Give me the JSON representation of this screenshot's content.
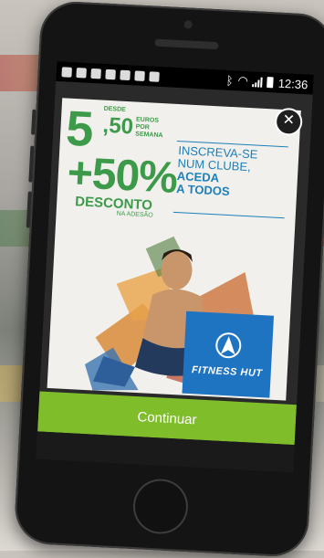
{
  "statusbar": {
    "time": "12:36"
  },
  "ad": {
    "price_main": "5",
    "price_decimal": ",50",
    "price_prefix": "DESDE",
    "price_unit": "EUROS POR SEMANA",
    "discount": "+50%",
    "discount_label": "DESCONTO",
    "discount_note": "NA ADESÃO",
    "slogan_line1": "INSCREVA-SE",
    "slogan_line2": "NUM CLUBE,",
    "slogan_line3": "ACEDA",
    "slogan_line4": "A TODOS",
    "brand": "FITNESS HUT"
  },
  "close_label": "✕",
  "continue_label": "Continuar",
  "colors": {
    "brand_green": "#3d9a4a",
    "button_green": "#7fbe2a",
    "brand_blue": "#1f74c2"
  }
}
